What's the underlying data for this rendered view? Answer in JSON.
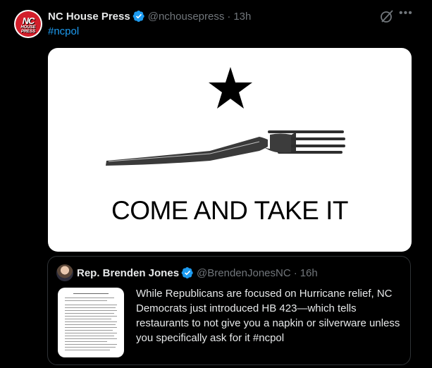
{
  "tweet": {
    "avatar_text": "NC",
    "avatar_sub": "HOUSE PRESS",
    "author_name": "NC House Press",
    "handle": "@nchousepress",
    "separator": "·",
    "time": "13h",
    "hashtag": "#ncpol",
    "image_caption": "COME AND TAKE IT"
  },
  "quote": {
    "author_name": "Rep. Brenden Jones",
    "handle": "@BrendenJonesNC",
    "separator": "·",
    "time": "16h",
    "text": "While Republicans are focused on Hurricane relief, NC Democrats just introduced HB 423—which tells restaurants to not give you a napkin or silverware unless you specifically ask for it #ncpol"
  },
  "icons": {
    "verified": "verified-badge-icon",
    "grok": "grok-icon",
    "more": "more-icon"
  },
  "colors": {
    "background": "#000000",
    "text": "#e7e9ea",
    "secondary": "#71767b",
    "accent": "#1d9bf0",
    "border": "#2f3336"
  }
}
